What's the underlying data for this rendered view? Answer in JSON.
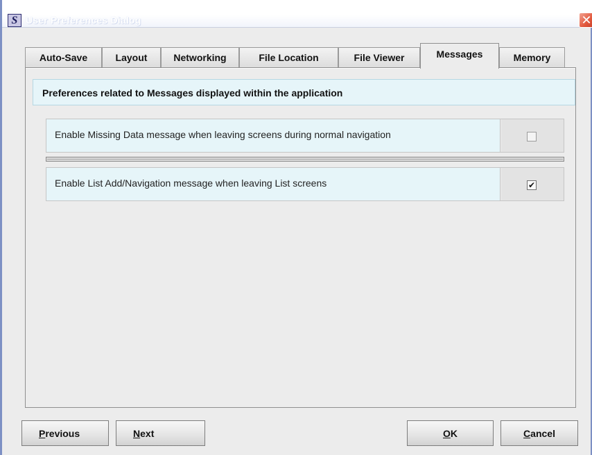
{
  "window": {
    "title": "User Preferences Dialog",
    "app_icon_letter": "S",
    "close_glyph": "✕"
  },
  "tabs": [
    {
      "label": "Auto-Save",
      "selected": false
    },
    {
      "label": "Layout",
      "selected": false
    },
    {
      "label": "Networking",
      "selected": false
    },
    {
      "label": "File Location",
      "selected": false
    },
    {
      "label": "File Viewer",
      "selected": false
    },
    {
      "label": "Messages",
      "selected": true
    },
    {
      "label": "Memory",
      "selected": false
    }
  ],
  "panel": {
    "heading": "Preferences related to Messages displayed within the application",
    "preferences": [
      {
        "label": "Enable Missing Data message when leaving screens during normal navigation",
        "checked": false,
        "check_glyph": ""
      },
      {
        "label": "Enable List Add/Navigation message when leaving List screens",
        "checked": true,
        "check_glyph": "✔"
      }
    ]
  },
  "buttons": {
    "previous": {
      "mnemonic": "P",
      "rest": "revious"
    },
    "next": {
      "mnemonic": "N",
      "rest": "ext"
    },
    "ok": {
      "mnemonic": "O",
      "rest": "K"
    },
    "cancel": {
      "mnemonic": "C",
      "rest": "ancel"
    }
  },
  "colors": {
    "title_bar": "#ffffff",
    "window_border": "#7d90c4",
    "close_button": "#e2583d",
    "heading_band": "#e6f5f9",
    "background": "#ececec"
  },
  "icons": {
    "app": "app-logo-icon",
    "close": "close-icon",
    "check": "checkmark-icon"
  }
}
